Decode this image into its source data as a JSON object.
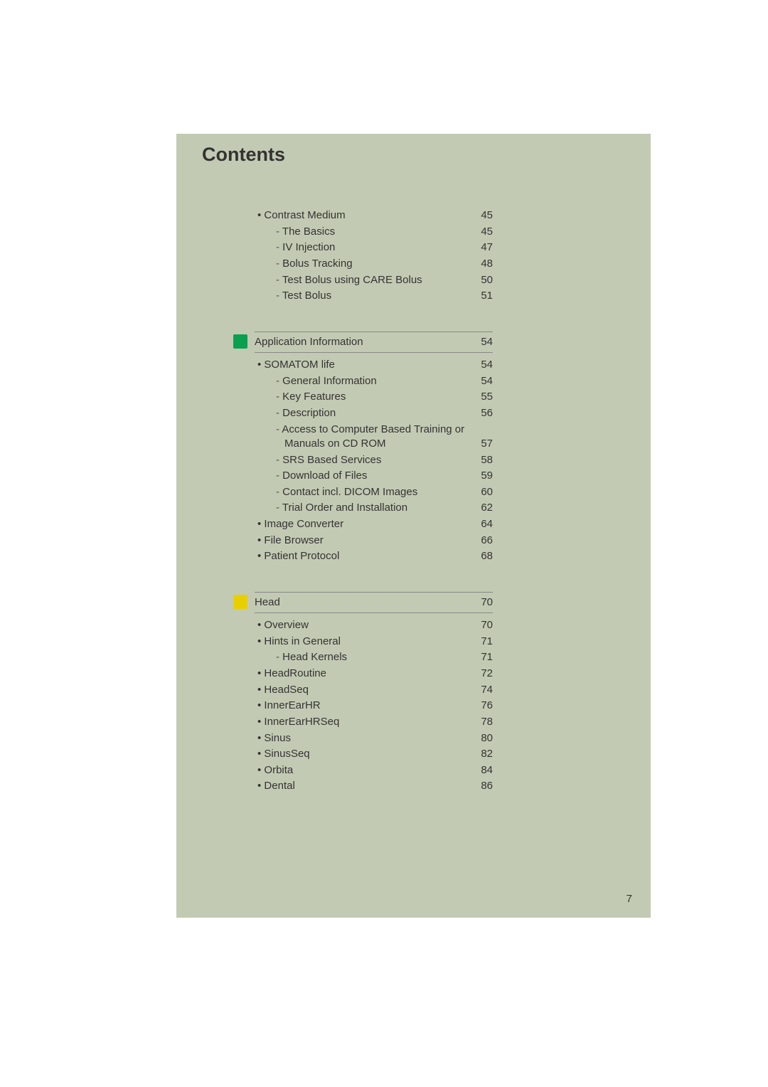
{
  "title": "Contents",
  "page_number": "7",
  "group0": {
    "items": [
      {
        "level": "bullet",
        "label": "Contrast Medium",
        "page": "45"
      },
      {
        "level": "dash",
        "label": "The Basics",
        "page": "45"
      },
      {
        "level": "dash",
        "label": "IV Injection",
        "page": "47"
      },
      {
        "level": "dash",
        "label": "Bolus Tracking",
        "page": "48"
      },
      {
        "level": "dash",
        "label": "Test Bolus using CARE Bolus",
        "page": "50"
      },
      {
        "level": "dash",
        "label": "Test Bolus",
        "page": "51"
      }
    ]
  },
  "section1": {
    "chip_color": "green",
    "heading": "Application Information",
    "heading_page": "54",
    "items": [
      {
        "level": "bullet",
        "label": "SOMATOM life",
        "page": "54"
      },
      {
        "level": "dash",
        "label": "General Information",
        "page": "54"
      },
      {
        "level": "dash",
        "label": "Key Features",
        "page": "55"
      },
      {
        "level": "dash",
        "label": "Description",
        "page": "56"
      },
      {
        "level": "dash-wrap",
        "label": "Access to Computer Based Training or",
        "label2": "Manuals on CD ROM",
        "page": "57"
      },
      {
        "level": "dash",
        "label": "SRS Based Services",
        "page": "58"
      },
      {
        "level": "dash",
        "label": "Download of Files",
        "page": "59"
      },
      {
        "level": "dash",
        "label": "Contact incl. DICOM Images",
        "page": "60"
      },
      {
        "level": "dash",
        "label": "Trial Order and Installation",
        "page": "62"
      },
      {
        "level": "bullet",
        "label": "Image Converter",
        "page": "64"
      },
      {
        "level": "bullet",
        "label": "File Browser",
        "page": "66"
      },
      {
        "level": "bullet",
        "label": "Patient Protocol",
        "page": "68"
      }
    ]
  },
  "section2": {
    "chip_color": "yellow",
    "heading": "Head",
    "heading_page": "70",
    "items": [
      {
        "level": "bullet",
        "label": "Overview",
        "page": "70"
      },
      {
        "level": "bullet",
        "label": "Hints in General",
        "page": "71"
      },
      {
        "level": "dash",
        "label": "Head Kernels",
        "page": "71"
      },
      {
        "level": "bullet",
        "label": "HeadRoutine",
        "page": "72"
      },
      {
        "level": "bullet",
        "label": "HeadSeq",
        "page": "74"
      },
      {
        "level": "bullet",
        "label": "InnerEarHR",
        "page": "76"
      },
      {
        "level": "bullet",
        "label": "InnerEarHRSeq",
        "page": "78"
      },
      {
        "level": "bullet",
        "label": "Sinus",
        "page": "80"
      },
      {
        "level": "bullet",
        "label": "SinusSeq",
        "page": "82"
      },
      {
        "level": "bullet",
        "label": "Orbita",
        "page": "84"
      },
      {
        "level": "bullet",
        "label": "Dental",
        "page": "86"
      }
    ]
  }
}
